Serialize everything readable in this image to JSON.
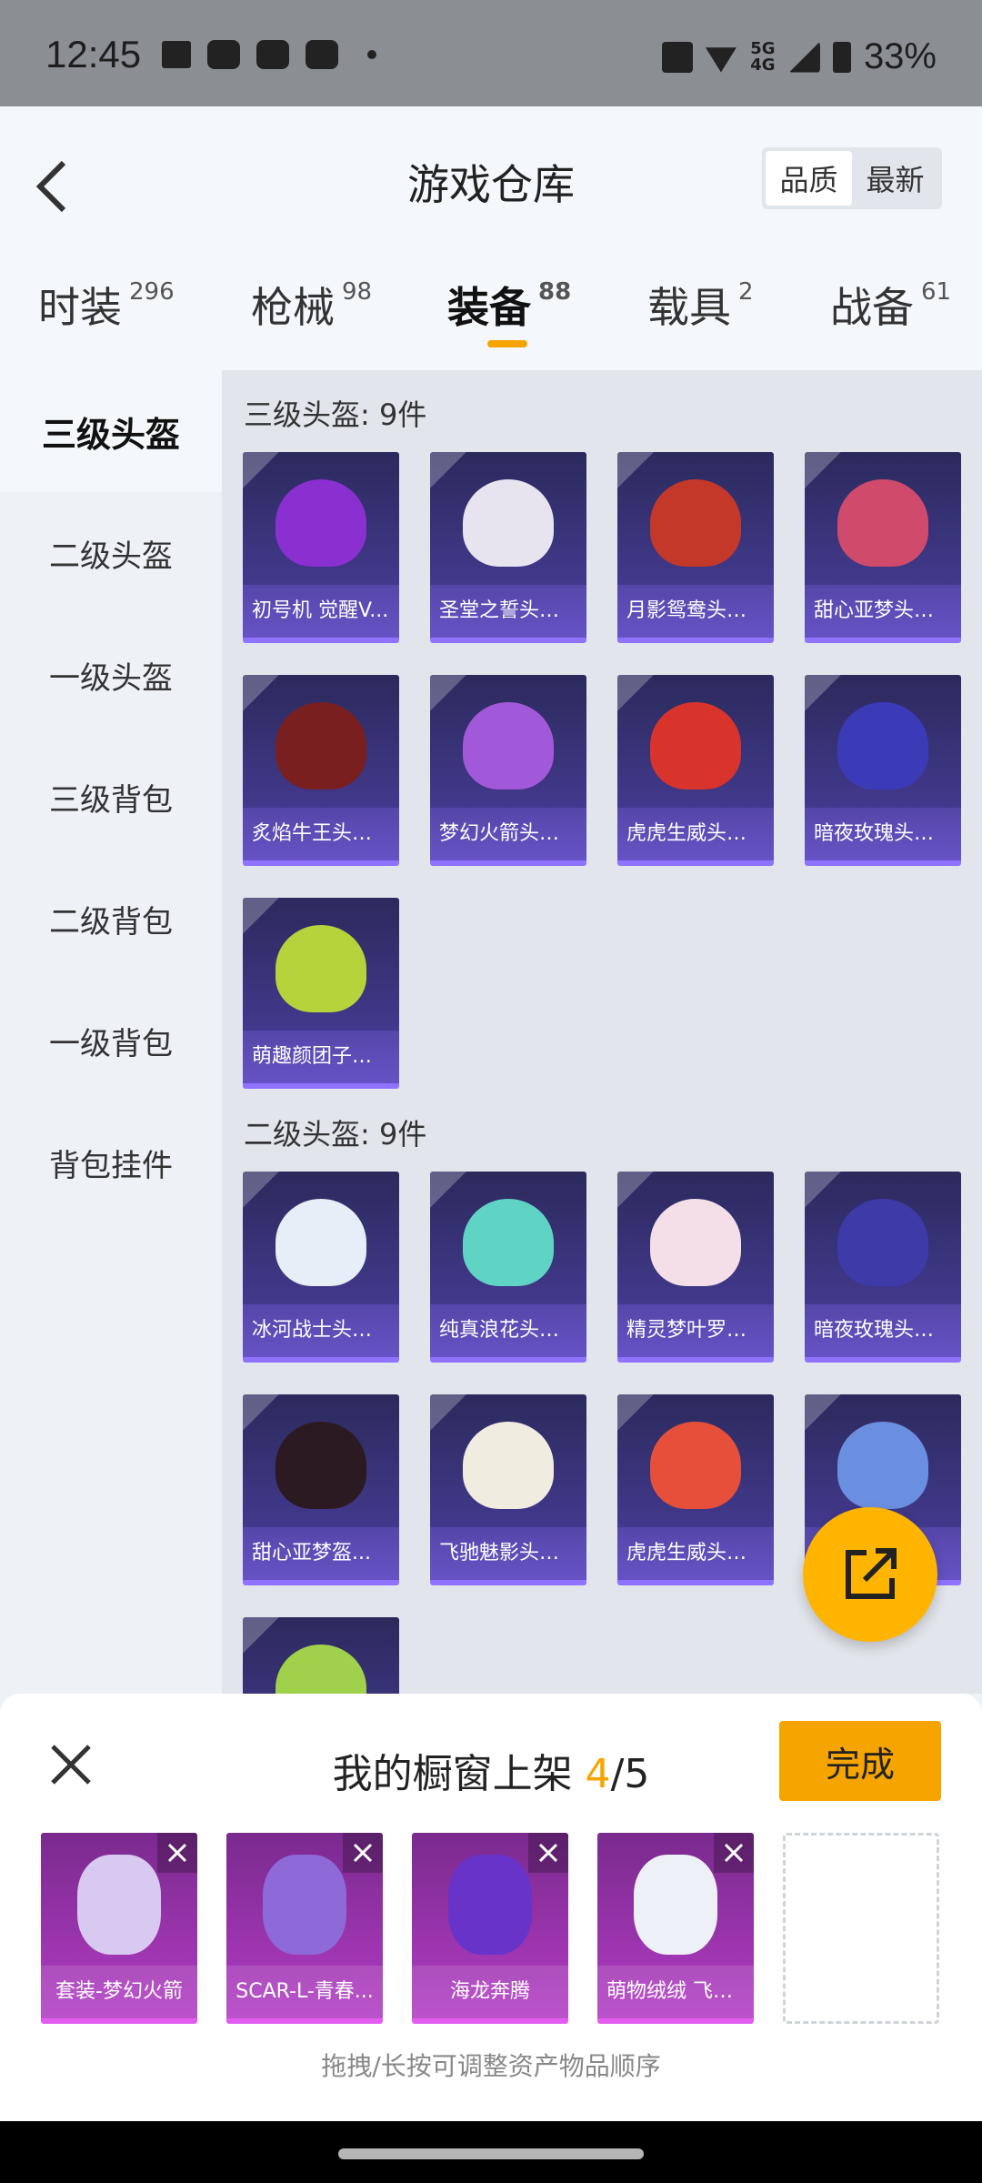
{
  "status_bar": {
    "time": "12:45",
    "network": "5G\n4G",
    "battery": "33%"
  },
  "header": {
    "title": "游戏仓库",
    "sort_options": [
      "品质",
      "最新"
    ],
    "sort_active": "品质"
  },
  "tabs": [
    {
      "label": "时装",
      "count": "296"
    },
    {
      "label": "枪械",
      "count": "98"
    },
    {
      "label": "装备",
      "count": "88"
    },
    {
      "label": "载具",
      "count": "2"
    },
    {
      "label": "战备",
      "count": "61"
    }
  ],
  "active_tab": "装备",
  "sidebar": [
    "三级头盔",
    "二级头盔",
    "一级头盔",
    "三级背包",
    "二级背包",
    "一级背包",
    "背包挂件"
  ],
  "sections": [
    {
      "title": "三级头盔: 9件",
      "items": [
        "初号机 觉醒V...",
        "圣堂之誓头盔...",
        "月影鸳鸯头盔...",
        "甜心亚梦头盔...",
        "炙焰牛王头盔...",
        "梦幻火箭头盔...",
        "虎虎生威头盔...",
        "暗夜玫瑰头盔...",
        "萌趣颜团子头..."
      ],
      "art_colors": [
        "#8a2fd0",
        "#e8e4ef",
        "#c4382a",
        "#d04b6b",
        "#7a1f1f",
        "#a259d9",
        "#d9342b",
        "#3b3bb8",
        "#b6d33b"
      ]
    },
    {
      "title": "二级头盔: 9件",
      "items": [
        "冰河战士头盔...",
        "纯真浪花头盔...",
        "精灵梦叶罗丽...",
        "暗夜玫瑰头盔...",
        "甜心亚梦盔...",
        "飞驰魅影头盔...",
        "虎虎生威头盔...",
        "",
        ""
      ],
      "art_colors": [
        "#e6eef7",
        "#5fd4c5",
        "#f4dfe8",
        "#3e3aa8",
        "#2c1a22",
        "#f1ece0",
        "#e6503b",
        "#6b8fe0",
        "#9fd24a"
      ]
    }
  ],
  "showcase": {
    "title": "我的橱窗上架",
    "count": "4",
    "max": "/5",
    "done": "完成",
    "items": [
      "套装-梦幻火箭",
      "SCAR-L-青春...",
      "海龙奔腾",
      "萌物绒绒 飞行..."
    ],
    "art_colors": [
      "#d8c9f0",
      "#8d6ad8",
      "#6733c9",
      "#eef0f8"
    ],
    "hint": "拖拽/长按可调整资产物品顺序"
  },
  "colors": {
    "accent": "#f5a400",
    "card_bg": "#3b3484",
    "showcase_bg": "#a035b8"
  }
}
